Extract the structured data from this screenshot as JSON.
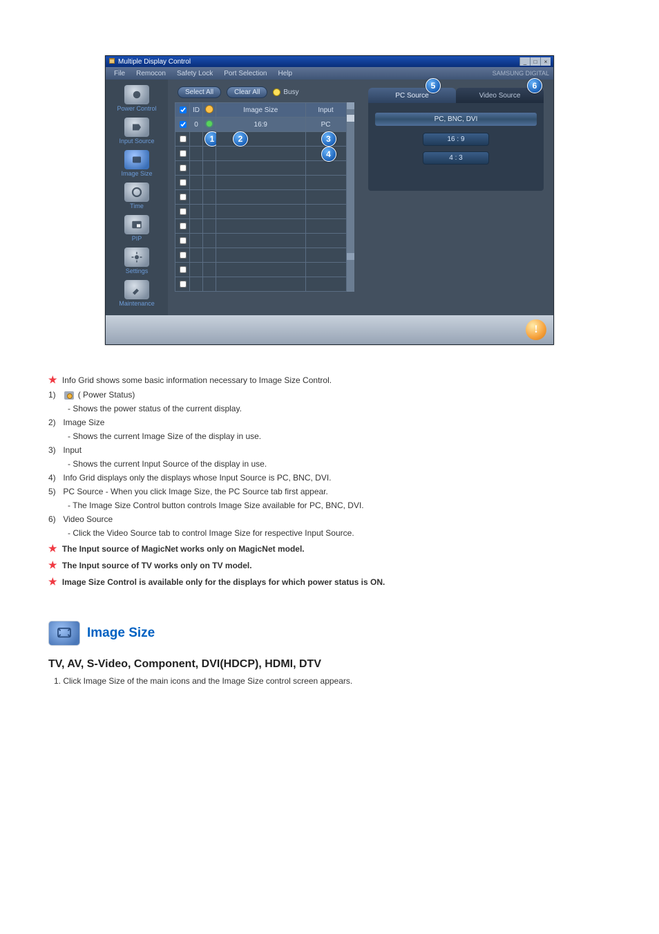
{
  "app": {
    "title": "Multiple Display Control",
    "menus": [
      "File",
      "Remocon",
      "Safety Lock",
      "Port Selection",
      "Help"
    ],
    "brand": "SAMSUNG DIGITAL"
  },
  "sidebar": {
    "items": [
      {
        "label": "Power Control"
      },
      {
        "label": "Input Source"
      },
      {
        "label": "Image Size"
      },
      {
        "label": "Time"
      },
      {
        "label": "PIP"
      },
      {
        "label": "Settings"
      },
      {
        "label": "Maintenance"
      }
    ]
  },
  "toolbar": {
    "select_all": "Select All",
    "clear_all": "Clear All",
    "busy": "Busy"
  },
  "grid": {
    "headers": {
      "id": "ID",
      "power": "",
      "image_size": "Image Size",
      "input": "Input"
    },
    "rows": [
      {
        "checked": true,
        "id": "0",
        "power": "on",
        "image_size": "16:9",
        "input": "PC"
      }
    ],
    "empty_rows": 10
  },
  "callouts": {
    "c1": "1",
    "c2": "2",
    "c3": "3",
    "c4": "4",
    "c5": "5",
    "c6": "6"
  },
  "panel": {
    "tabs": {
      "pc": "PC Source",
      "video": "Video Source"
    },
    "heading": "PC, BNC, DVI",
    "options": [
      "16 : 9",
      "4 : 3"
    ]
  },
  "help_glyph": "!",
  "doc": {
    "intro": "Info Grid shows some basic information necessary to Image Size Control.",
    "items": [
      {
        "num": "1)",
        "title": "( Power Status)",
        "sub": "- Shows the power status of the current display."
      },
      {
        "num": "2)",
        "title": "Image Size",
        "sub": "- Shows the current Image Size of the display in use."
      },
      {
        "num": "3)",
        "title": "Input",
        "sub": "- Shows the current Input Source of the display in use."
      },
      {
        "num": "4)",
        "title": "Info Grid displays only the displays whose Input Source is PC, BNC, DVI.",
        "sub": ""
      },
      {
        "num": "5)",
        "title": "PC Source - When you click Image Size, the PC Source tab first appear.",
        "sub": "- The Image Size Control button controls Image Size available for PC, BNC, DVI."
      },
      {
        "num": "6)",
        "title": "Video Source",
        "sub": "- Click the Video Source tab to control Image Size for respective Input Source."
      }
    ],
    "notes": [
      "The Input source of MagicNet works only on MagicNet model.",
      "The Input source of TV works only on TV model.",
      "Image Size Control is available only for the displays for which power status is ON."
    ],
    "section_title": "Image Size",
    "sub_heading": "TV, AV, S-Video, Component, DVI(HDCP), HDMI, DTV",
    "step1": "1. Click Image Size of the main icons and the Image Size control screen appears."
  }
}
